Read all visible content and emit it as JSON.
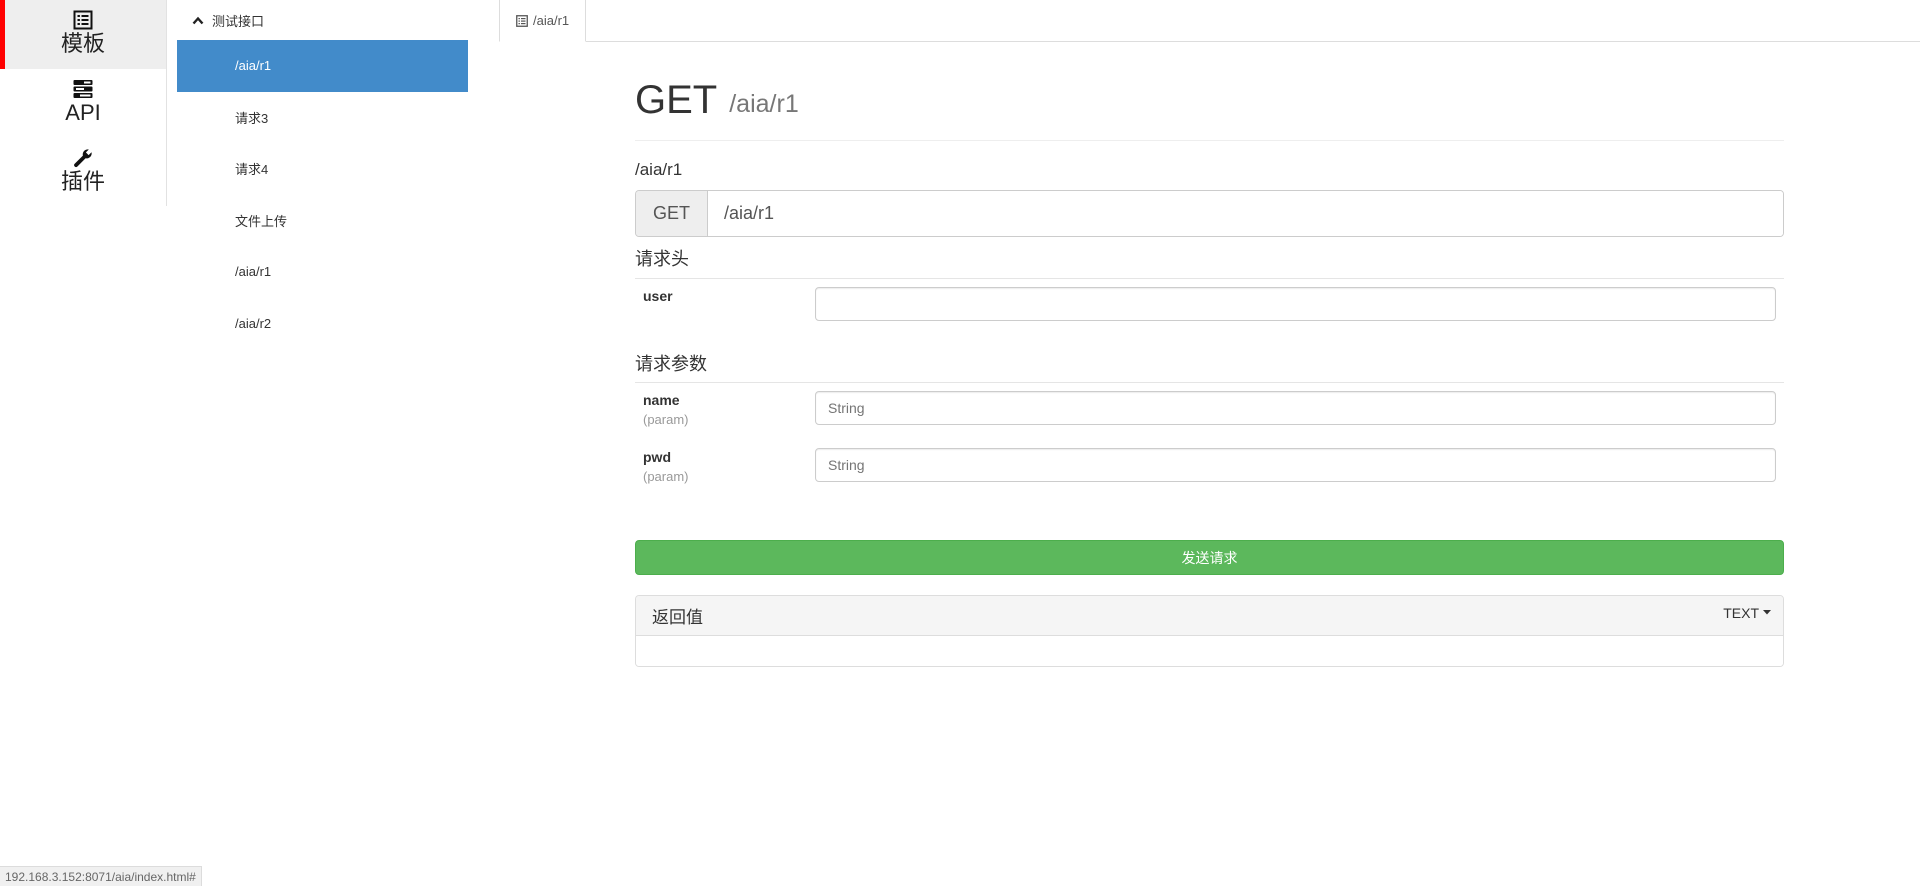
{
  "rail": {
    "items": [
      {
        "label": "模板",
        "icon": "list-alt-icon",
        "active": true
      },
      {
        "label": "API",
        "icon": "tasks-icon",
        "active": false
      },
      {
        "label": "插件",
        "icon": "wrench-icon",
        "active": false
      }
    ]
  },
  "tree": {
    "group_label": "测试接口",
    "items": [
      {
        "label": "/aia/r1",
        "active": true
      },
      {
        "label": "请求3"
      },
      {
        "label": "请求4"
      },
      {
        "label": "文件上传"
      },
      {
        "label": "/aia/r1"
      },
      {
        "label": "/aia/r2"
      }
    ]
  },
  "tabs": [
    {
      "label": "/aia/r1",
      "icon": "list-alt-icon"
    }
  ],
  "main": {
    "method": "GET",
    "path": "/aia/r1",
    "sub_path": "/aia/r1",
    "url_method": "GET",
    "url_value": "/aia/r1",
    "headers_title": "请求头",
    "headers": [
      {
        "name": "user",
        "kind": "",
        "value": "",
        "placeholder": ""
      }
    ],
    "params_title": "请求参数",
    "params": [
      {
        "name": "name",
        "kind": "(param)",
        "value": "",
        "placeholder": "String"
      },
      {
        "name": "pwd",
        "kind": "(param)",
        "value": "",
        "placeholder": "String"
      }
    ],
    "send_label": "发送请求",
    "result_title": "返回值",
    "result_format": "TEXT"
  },
  "status_url": "192.168.3.152:8071/aia/index.html#",
  "colors": {
    "accent_red": "#ff0000",
    "active_blue": "#428bca",
    "send_green": "#5cb85c"
  }
}
